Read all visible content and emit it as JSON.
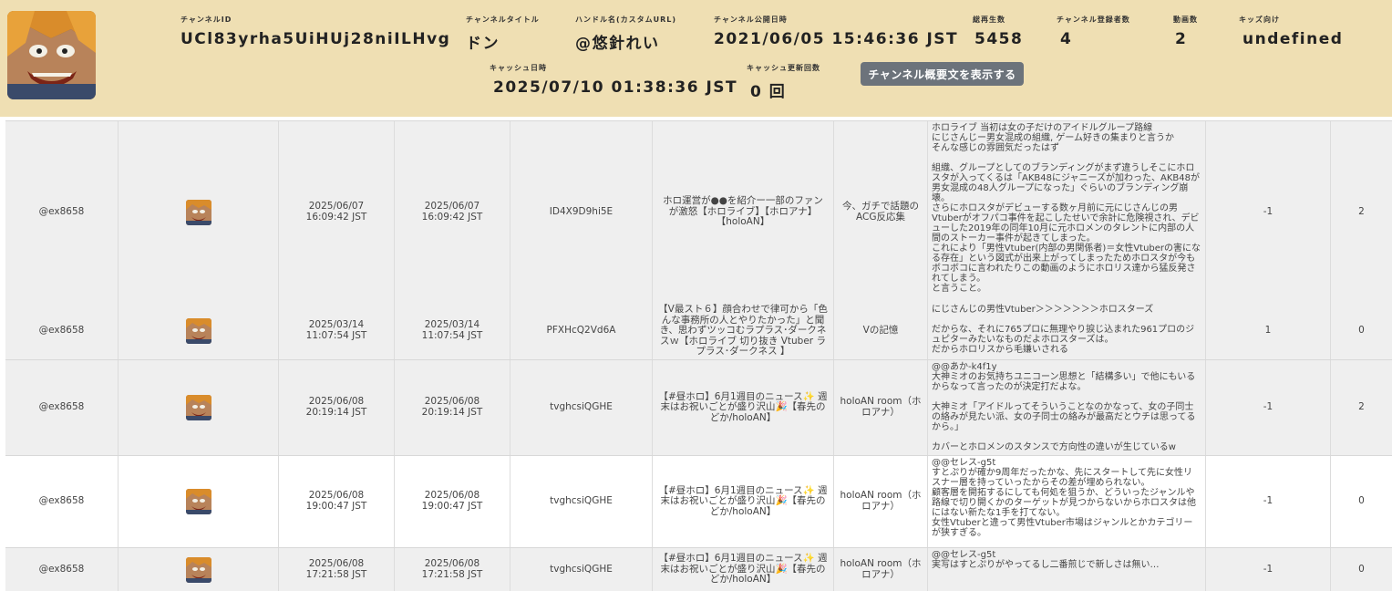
{
  "header": {
    "channel_id": {
      "label": "チャンネルID",
      "value": "UCl83yrha5UiHUj28niILHvg"
    },
    "channel_title": {
      "label": "チャンネルタイトル",
      "value": "ドン"
    },
    "handle": {
      "label": "ハンドル名(カスタムURL)",
      "value": "@悠針れい"
    },
    "published": {
      "label": "チャンネル公開日時",
      "value": "2021/06/05 15:46:36 JST"
    },
    "views": {
      "label": "総再生数",
      "value": "5458"
    },
    "subscribers": {
      "label": "チャンネル登録者数",
      "value": "4"
    },
    "videos": {
      "label": "動画数",
      "value": "2"
    },
    "kids": {
      "label": "キッズ向け",
      "value": "undefined"
    },
    "cached_at": {
      "label": "キャッシュ日時",
      "value": "2025/07/10 01:38:36 JST"
    },
    "cache_updates": {
      "label": "キャッシュ更新回数",
      "value": "0 回"
    },
    "desc_button": "チャンネル概要文を表示する"
  },
  "rows": [
    {
      "author": "@ex8658",
      "date1": "2025/06/07\n16:09:42 JST",
      "date2": "2025/06/07\n16:09:42 JST",
      "video_id": "ID4X9D9hi5E",
      "video_title": "ホロ運営が●●を紹介ー一部のファンが激怒【ホロライブ】【ホロアナ】【holoAN】",
      "channel": "今、ガチで話題のACG反応集",
      "comment": "ホロライブ 当初は女の子だけのアイドルグループ路線\nにじさんじー男女混成の組織, ゲーム好きの集まりと言うか\nそんな感じの雰囲気だったはず\n\n組織、グループとしてのブランディングがまず違うしそこにホロスタが入ってくるは「AKB48にジャニーズが加わった、AKB48が男女混成の48人グループになった」ぐらいのブランディング崩壊。\nさらにホロスタがデビューする数ヶ月前に元にじさんじの男Vtuberがオフパコ事件を起こしたせいで余計に危険視され、デビューした2019年の同年10月に元ホロメンのタレントに内部の人間のストーカー事件が起きてしまった。\nこれにより「男性Vtuber(内部の男関係者)＝女性Vtuberの害になる存在」という図式が出来上がってしまったためホロスタが今もボコボコに言われたりこの動画のようにホロリス達から猛反発されてしまう。\nと言うこと。",
      "likes": "-1",
      "replies": "2"
    },
    {
      "author": "@ex8658",
      "date1": "2025/03/14\n11:07:54 JST",
      "date2": "2025/03/14\n11:07:54 JST",
      "video_id": "PFXHcQ2Vd6A",
      "video_title": "【V最スト６】顔合わせで律可から「色んな事務所の人とやりたかった」と聞き、思わずツッコむラプラス･ダークネスｗ【ホロライブ 切り抜き Vtuber ラプラス･ダークネス 】",
      "channel": "Vの記憶",
      "comment": "にじさんじの男性Vtuber＞＞＞＞＞＞＞ホロスターズ\n\nだからな、それに765プロに無理やり捩じ込まれた961プロのジュピターみたいなものだよホロスターズは。\nだからホロリスから毛嫌いされる",
      "likes": "1",
      "replies": "0"
    },
    {
      "author": "@ex8658",
      "date1": "2025/06/08\n20:19:14 JST",
      "date2": "2025/06/08\n20:19:14 JST",
      "video_id": "tvghcsiQGHE",
      "video_title": "【#昼ホロ】6月1週目のニュース✨ 週末はお祝いごとが盛り沢山🎉【春先のどか/holoAN】",
      "channel": "holoAN room（ホロアナ）",
      "comment": "@@あか-k4f1y\n大神ミオのお気持ちユニコーン思想と「結構多い」で他にもいるからなって言ったのが決定打だよな。\n\n大神ミオ「アイドルってそういうことなのかなって、女の子同士の絡みが見たい派、女の子同士の絡みが最高だとウチは思ってるから。」\n\nカバーとホロメンのスタンスで方向性の違いが生じているw",
      "likes": "-1",
      "replies": "2"
    },
    {
      "author": "@ex8658",
      "date1": "2025/06/08\n19:00:47 JST",
      "date2": "2025/06/08\n19:00:47 JST",
      "video_id": "tvghcsiQGHE",
      "video_title": "【#昼ホロ】6月1週目のニュース✨ 週末はお祝いごとが盛り沢山🎉【春先のどか/holoAN】",
      "channel": "holoAN room（ホロアナ）",
      "comment": "@@セレス-g5t\nすとぷりが確か9周年だったかな、先にスタートして先に女性リスナー層を持っていったからその差が埋められない。\n顧客層を開拓するにしても何処を狙うか、どういったジャンルや路線で切り開くかのターゲットが見つからないからホロスタは他にはない新たな1手を打てない。\n女性Vtuberと違って男性Vtuber市場はジャンルとかカテゴリーが狭すぎる。",
      "likes": "-1",
      "replies": "0"
    },
    {
      "author": "@ex8658",
      "date1": "2025/06/08\n17:21:58 JST",
      "date2": "2025/06/08\n17:21:58 JST",
      "video_id": "tvghcsiQGHE",
      "video_title": "【#昼ホロ】6月1週目のニュース✨ 週末はお祝いごとが盛り沢山🎉【春先のどか/holoAN】",
      "channel": "holoAN room（ホロアナ）",
      "comment": "@@セレス-g5t\n実写はすとぷりがやってるし二番煎じで新しさは無い…",
      "likes": "-1",
      "replies": "0"
    }
  ],
  "icons": {
    "avatar": "avatar-image"
  },
  "colors": {
    "header_bg": "#efdfb3",
    "button_bg": "#6c737b",
    "row_shade": "#efefef"
  }
}
